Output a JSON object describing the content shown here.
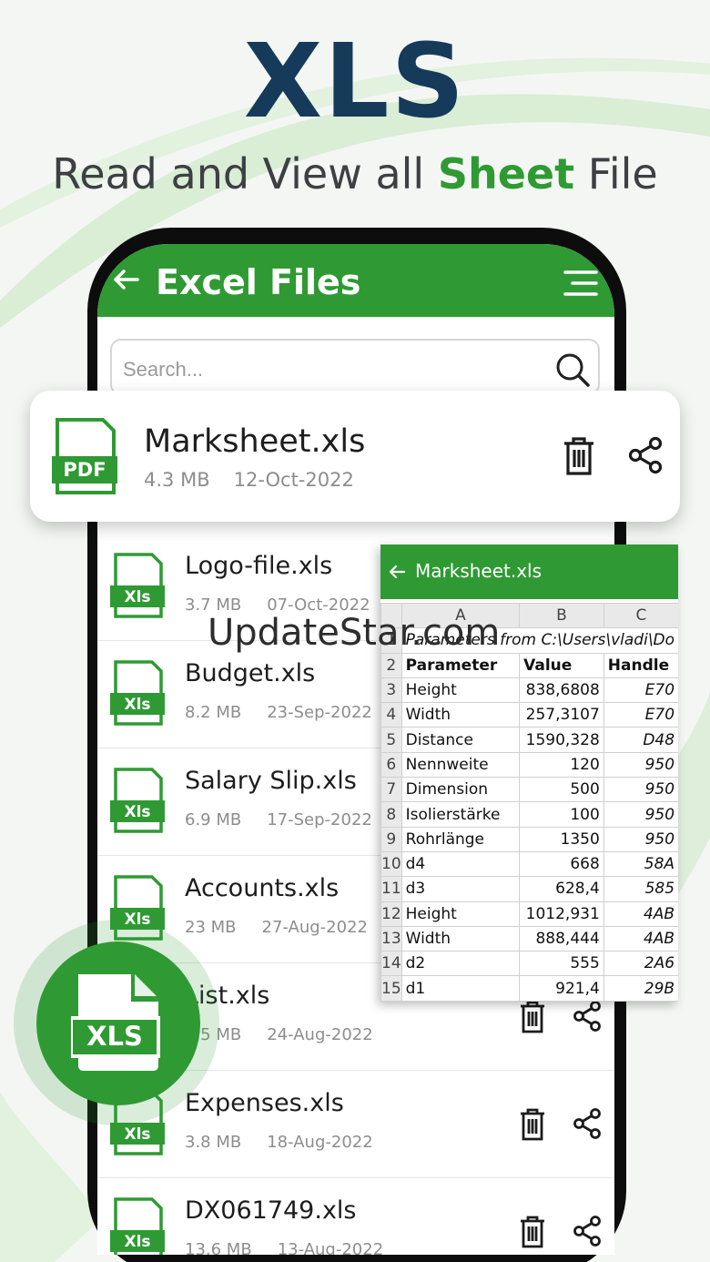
{
  "hero": {
    "title": "XLS",
    "subtitle_before": "Read and View all ",
    "subtitle_accent": "Sheet",
    "subtitle_after": " File"
  },
  "colors": {
    "accent": "#2f9a33",
    "title": "#163a5a"
  },
  "app": {
    "title": "Excel Files",
    "search_placeholder": "Search..."
  },
  "featured": {
    "name": "Marksheet.xls",
    "size": "4.3 MB",
    "date": "12-Oct-2022",
    "badge": "PDF"
  },
  "files": [
    {
      "name": "Logo-file.xls",
      "size": "3.7 MB",
      "date": "07-Oct-2022",
      "badge": "Xls"
    },
    {
      "name": "Budget.xls",
      "size": "8.2 MB",
      "date": "23-Sep-2022",
      "badge": "Xls"
    },
    {
      "name": "Salary Slip.xls",
      "size": "6.9 MB",
      "date": "17-Sep-2022",
      "badge": "Xls"
    },
    {
      "name": "Accounts.xls",
      "size": "23 MB",
      "date": "27-Aug-2022",
      "badge": "Xls"
    },
    {
      "name": "List.xls",
      "size": "2.5 MB",
      "date": "24-Aug-2022",
      "badge": "Xls"
    },
    {
      "name": "Expenses.xls",
      "size": "3.8 MB",
      "date": "18-Aug-2022",
      "badge": "Xls"
    },
    {
      "name": "DX061749.xls",
      "size": "13.6 MB",
      "date": "13-Aug-2022",
      "badge": "Xls"
    }
  ],
  "sheet": {
    "title": "Marksheet.xls",
    "columns": [
      "A",
      "B",
      "C"
    ],
    "header_row": "Parameters from C:\\Users\\vladi\\Do",
    "rows": [
      [
        "2",
        "Parameter",
        "Value",
        "Handle"
      ],
      [
        "3",
        "Height",
        "838,6808",
        "E70"
      ],
      [
        "4",
        "Width",
        "257,3107",
        "E70"
      ],
      [
        "5",
        "Distance",
        "1590,328",
        "D48"
      ],
      [
        "6",
        "Nennweite",
        "120",
        "950"
      ],
      [
        "7",
        "Dimension",
        "500",
        "950"
      ],
      [
        "8",
        "Isolierstärke",
        "100",
        "950"
      ],
      [
        "9",
        "Rohrlänge",
        "1350",
        "950"
      ],
      [
        "10",
        "d4",
        "668",
        "58A"
      ],
      [
        "11",
        "d3",
        "628,4",
        "585"
      ],
      [
        "12",
        "Height",
        "1012,931",
        "4AB"
      ],
      [
        "13",
        "Width",
        "888,444",
        "4AB"
      ],
      [
        "14",
        "d2",
        "555",
        "2A6"
      ],
      [
        "15",
        "d1",
        "921,4",
        "29B"
      ]
    ]
  },
  "watermark": "UpdateStar.com",
  "badge": {
    "label": "XLS"
  }
}
